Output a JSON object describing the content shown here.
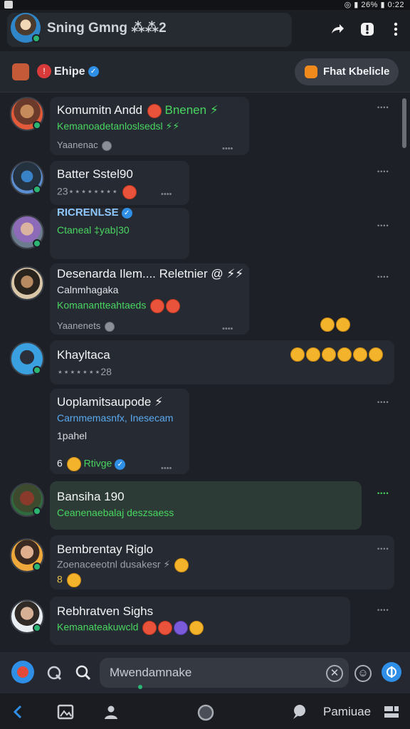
{
  "status": {
    "right": "◎ ▮ 26% ▮ 0:22"
  },
  "header": {
    "title": "Sning Gmng ⁂⁂2",
    "icons": [
      "share-icon",
      "info-icon",
      "more-vert-icon"
    ]
  },
  "filter": {
    "label": "Ehipe",
    "pill_label": "Fhat Kbelicle"
  },
  "messages": [
    {
      "name": "Komumitn Andd",
      "name_tail": "Bnenen ⚡",
      "line": "Kemanoadetanloslsedsl ⚡⚡",
      "meta": "Yaanenac",
      "time": "••••",
      "foot": "••••"
    },
    {
      "name": "Batter Sstel90",
      "line": "23⋆⋆⋆⋆⋆⋆⋆⋆",
      "foot": "••••",
      "time": "••••"
    },
    {
      "name": "RICRENLSE",
      "line": "Ctaneal ‡yab|30",
      "time": "••••"
    },
    {
      "name": "Desenarda Ilem.... Reletnier @ ⚡⚡",
      "line1": "Calnmhagaka",
      "line2": "Komanantteahtaeds",
      "meta": "Yaanenets",
      "foot": "••••",
      "time": "••••"
    },
    {
      "name": "Khayltaca",
      "line": "⋆⋆⋆⋆⋆⋆⋆28",
      "time": "••••"
    },
    {
      "name": "Uoplamitsaupode ⚡",
      "line1": "Carnmemasnfx, Inesecam",
      "line2": "1pahel",
      "foot_num": "6",
      "foot_lbl": "Rtivge",
      "foot": "••••",
      "time": "••••"
    },
    {
      "name": "Bansiha 190",
      "line": "Ceanenaebalaj deszsaess",
      "time": "••••"
    },
    {
      "name": "Bembrentay Riglo",
      "line": "Zoenaceeotnl dusakesr ⚡",
      "foot": "8",
      "time": "••••"
    },
    {
      "name": "Rebhratven Sighs",
      "line": "Kemanateakuwcld",
      "time": "••••"
    }
  ],
  "composer": {
    "placeholder": "Mwendamnake"
  },
  "navbar": {
    "label": "Pamiuae"
  },
  "colors": {
    "accent_green": "#49d660",
    "accent_blue": "#2f8fe6",
    "bg": "#1d2026"
  }
}
